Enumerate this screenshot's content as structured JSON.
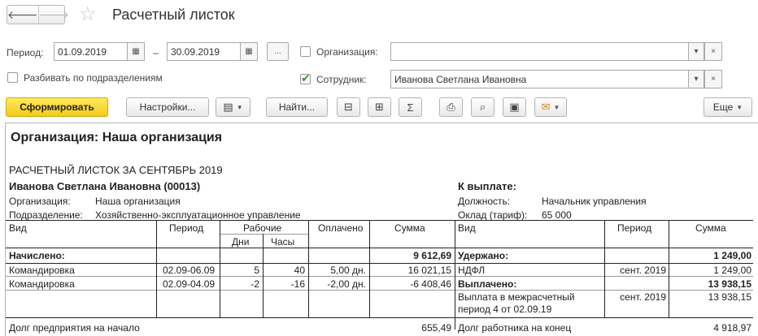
{
  "window": {
    "title": "Расчетный листок"
  },
  "filters": {
    "period_label": "Период:",
    "date_from": "01.09.2019",
    "date_to": "30.09.2019",
    "dash": "–",
    "more_btn": "...",
    "org_label": "Организация:",
    "org_value": "",
    "split_label": "Разбивать по подразделениям",
    "emp_label": "Сотрудник:",
    "emp_value": "Иванова Светлана Ивановна"
  },
  "toolbar": {
    "generate": "Сформировать",
    "settings": "Настройки...",
    "find": "Найти...",
    "sum": "Σ",
    "more": "Еще"
  },
  "report": {
    "org_heading": "Организация: Наша организация",
    "title": "РАСЧЕТНЫЙ ЛИСТОК ЗА СЕНТЯБРЬ 2019",
    "employee": "Иванова Светлана Ивановна (00013)",
    "org_k": "Организация:",
    "org_v": "Наша организация",
    "dept_k": "Подразделение:",
    "dept_v": "Хозяйственно-эксплуатационное управление",
    "pay_heading": "К выплате:",
    "pos_k": "Должность:",
    "pos_v": "Начальник управления",
    "salary_k": "Оклад (тариф):",
    "salary_v": "65 000",
    "cols": {
      "kind": "Вид",
      "period": "Период",
      "working": "Рабочие",
      "days": "Дни",
      "hours": "Часы",
      "paid": "Оплачено",
      "sum": "Сумма",
      "kind_r": "Вид",
      "period_r": "Период",
      "sum_r": "Сумма"
    },
    "accrued_label": "Начислено:",
    "accrued_total": "9 612,69",
    "accruals": [
      {
        "kind": "Командировка",
        "period": "02.09-06.09",
        "days": "5",
        "hours": "40",
        "paid": "5,00 дн.",
        "sum": "16 021,15"
      },
      {
        "kind": "Командировка",
        "period": "02.09-04.09",
        "days": "-2",
        "hours": "-16",
        "paid": "-2,00 дн.",
        "sum": "-6 408,46"
      }
    ],
    "withheld_label": "Удержано:",
    "withheld_total": "1 249,00",
    "ndfl": {
      "kind": "НДФЛ",
      "period": "сент. 2019",
      "sum": "1 249,00"
    },
    "paid_label": "Выплачено:",
    "paid_total": "13 938,15",
    "payout": {
      "kind_1": "Выплата в межрасчетный",
      "kind_2": "период 4 от 02.09.19",
      "period": "сент. 2019",
      "sum": "13 938,15"
    },
    "debt_company_label": "Долг предприятия на начало",
    "debt_company_value": "655,49",
    "debt_employee_label": "Долг работника на конец",
    "debt_employee_value": "4 918,97"
  }
}
